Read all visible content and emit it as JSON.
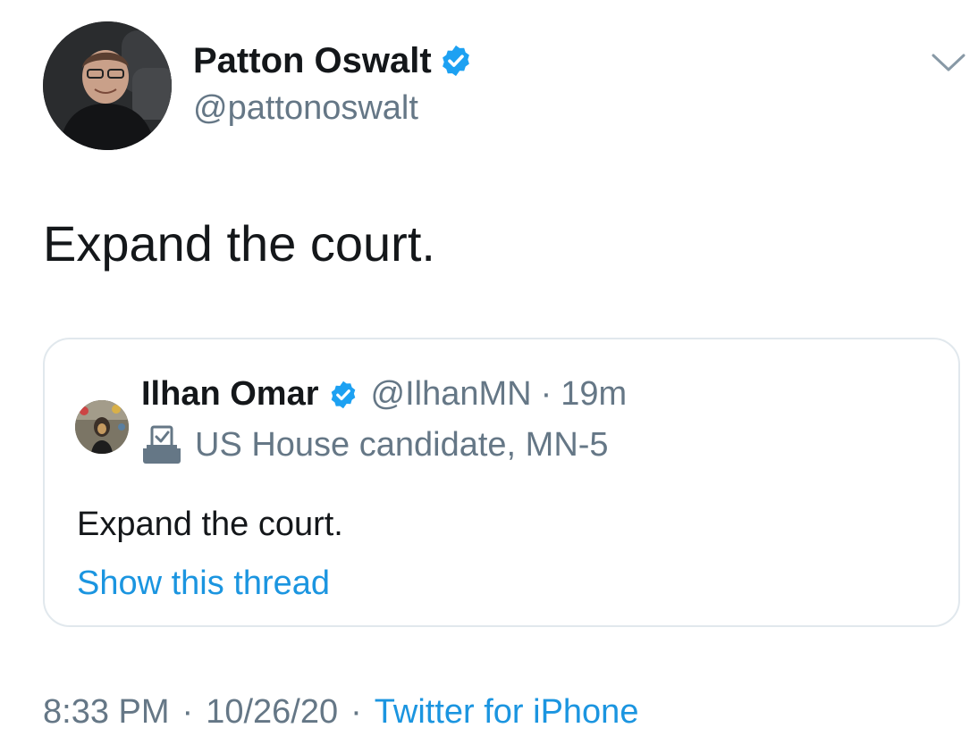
{
  "tweet": {
    "author": {
      "name": "Patton Oswalt",
      "handle": "@pattonoswalt",
      "verified": true
    },
    "text": "Expand the court.",
    "time": "8:33 PM",
    "date": "10/26/20",
    "source": "Twitter for iPhone",
    "separator": "·"
  },
  "quoted": {
    "author": {
      "name": "Ilhan Omar",
      "handle": "@IlhanMN",
      "verified": true
    },
    "separator": "·",
    "age": "19m",
    "label": "US House candidate, MN-5",
    "text": "Expand the court.",
    "show_thread": "Show this thread"
  },
  "colors": {
    "verified": "#1da1f2",
    "link": "#1b95e0",
    "secondary": "#657786",
    "border": "#e1e8ed"
  },
  "icons": {
    "verified": "verified-badge-icon",
    "caret": "chevron-down-icon",
    "election_label": "ballot-box-icon"
  }
}
